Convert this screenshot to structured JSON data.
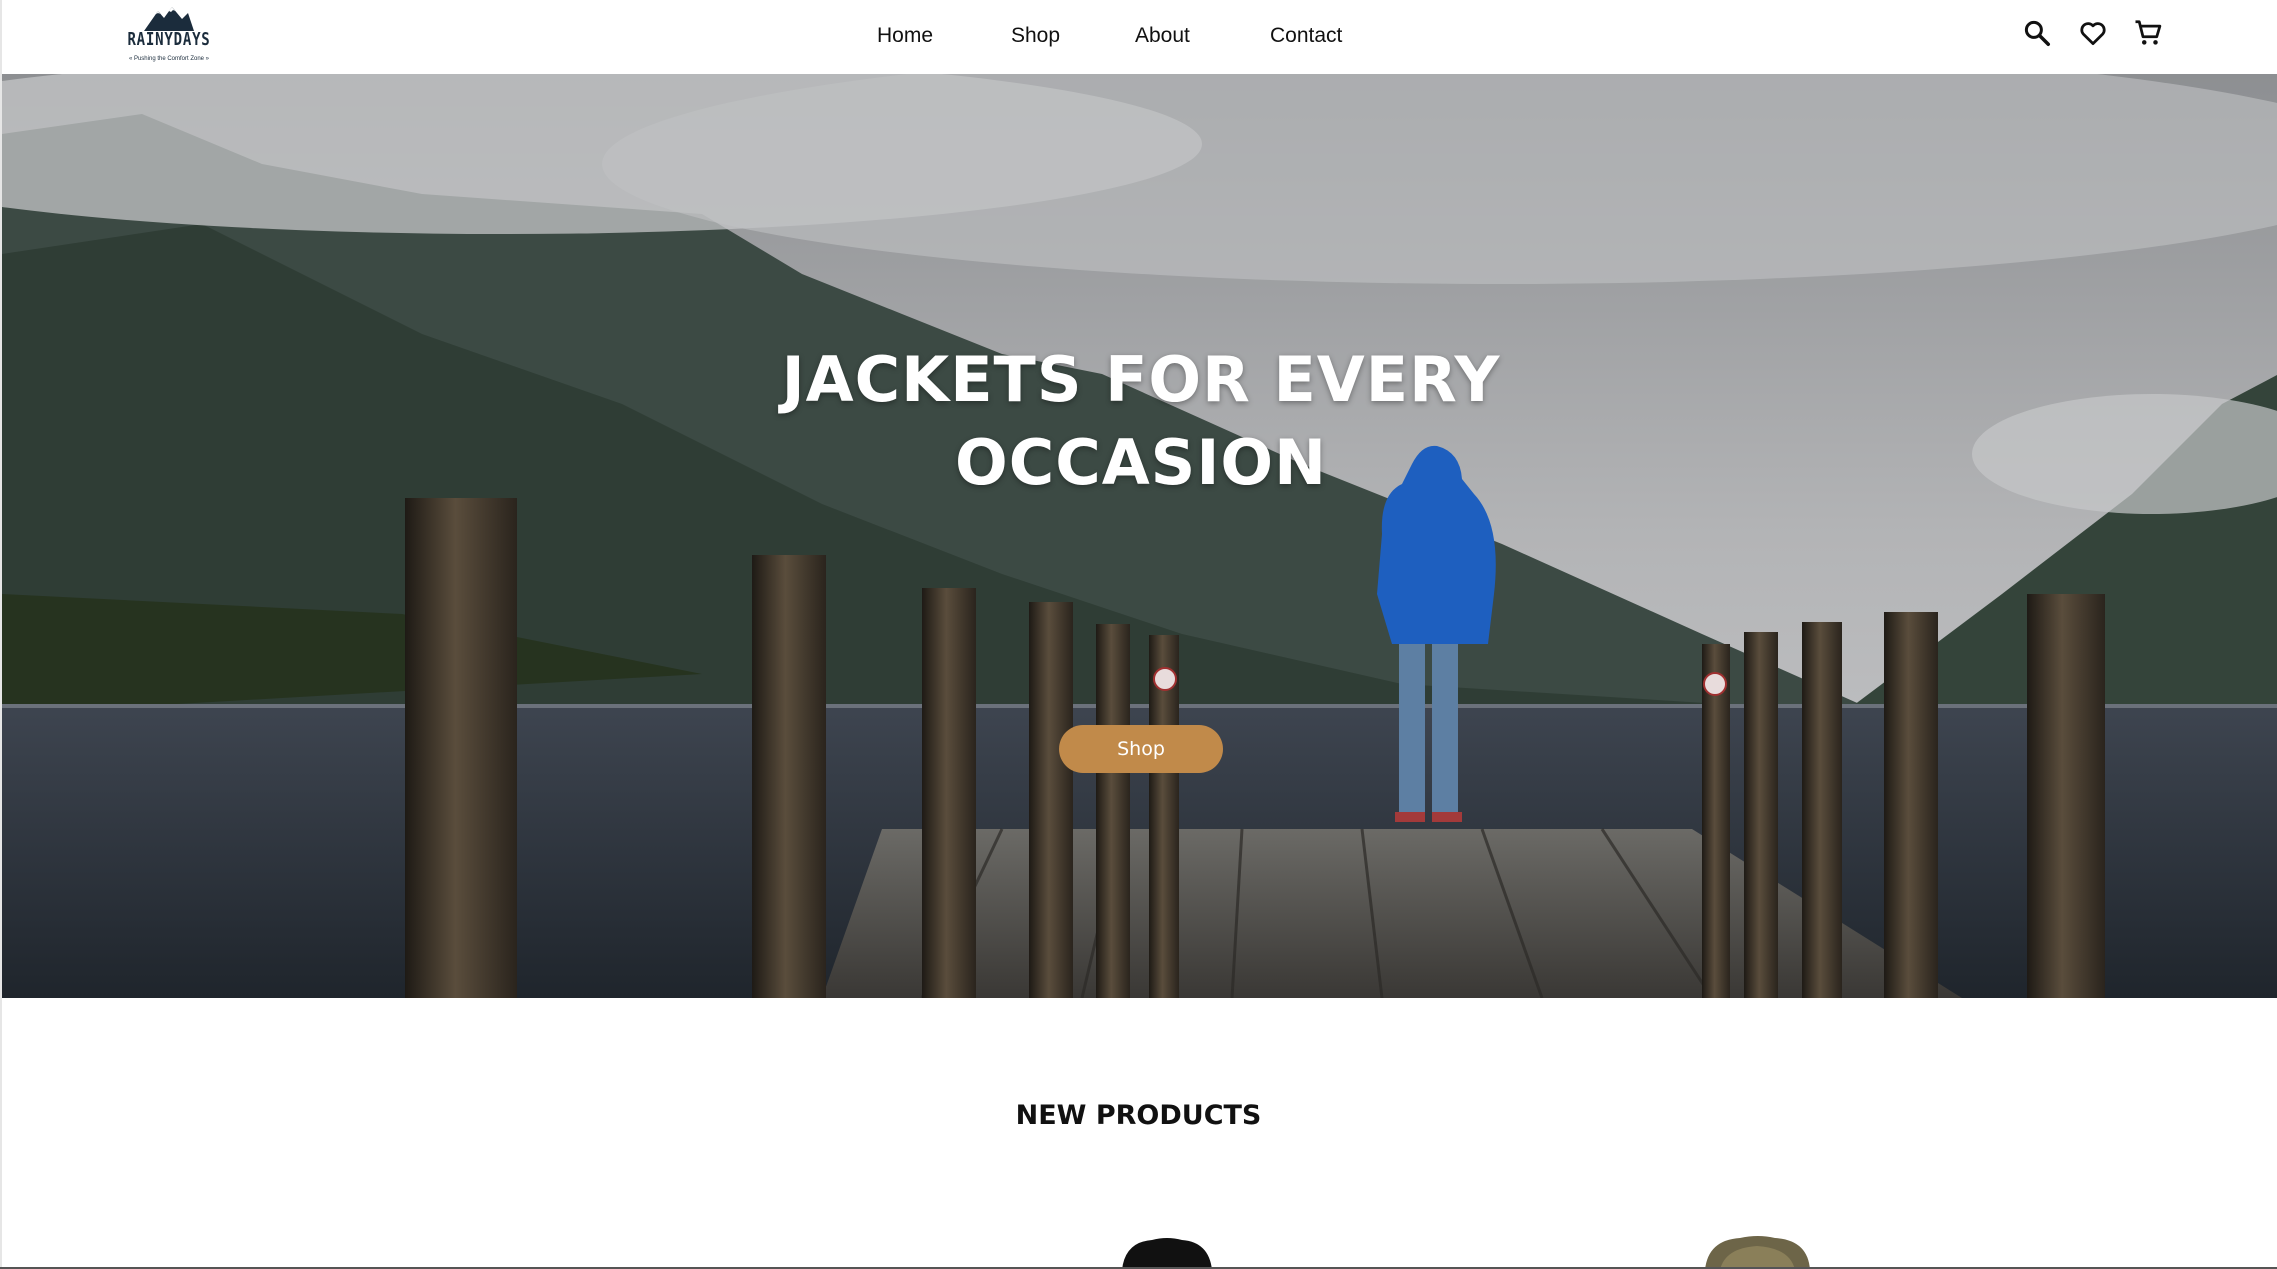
{
  "brand": {
    "name": "RAINYDAYS",
    "tagline": "« Pushing the Comfort Zone »"
  },
  "nav": {
    "home": "Home",
    "shop": "Shop",
    "about": "About",
    "contact": "Contact"
  },
  "header_icons": [
    "search-icon",
    "heart-icon",
    "cart-icon"
  ],
  "hero": {
    "title_line1": "JACKETS FOR EVERY",
    "title_line2": "OCCASION",
    "button_label": "Shop"
  },
  "new_products": {
    "title": "NEW PRODUCTS"
  },
  "colors": {
    "accent": "#c18a4a",
    "brand_dark": "#1b2c3c",
    "jacket": "#1e5fbf"
  }
}
